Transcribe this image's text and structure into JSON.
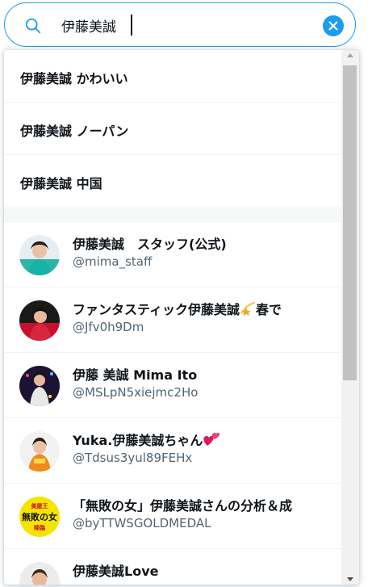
{
  "search": {
    "value": "伊藤美誠",
    "icons": {
      "search": "search-icon",
      "clear": "close-icon"
    }
  },
  "suggestions": [
    {
      "label": "伊藤美誠 かわいい"
    },
    {
      "label": "伊藤美誠 ノーパン"
    },
    {
      "label": "伊藤美誠 中国"
    }
  ],
  "users": [
    {
      "name": "伊藤美誠　スタッフ(公式)",
      "handle": "@mima_staff",
      "avatar": "avatar-photo"
    },
    {
      "name": "ファンタスティック伊藤美誠",
      "name_suffix": "春で",
      "name_emoji": "shooting-star-icon",
      "handle": "@Jfv0h9Dm",
      "avatar": "avatar-photo"
    },
    {
      "name": "伊藤 美誠 Mima Ito",
      "handle": "@MSLpN5xiejmc2Ho",
      "avatar": "avatar-photo"
    },
    {
      "name": "Yuka.伊藤美誠ちゃん",
      "name_emoji": "two-hearts-icon",
      "handle": "@Tdsus3yul89FEHx",
      "avatar": "avatar-photo"
    },
    {
      "name": "「無敗の女」伊藤美誠さんの分析＆成",
      "handle": "@byTTWSGOLDMEDAL",
      "avatar": "avatar-logo",
      "avatar_text": {
        "top": "美屋王",
        "main": "無敗の女",
        "bottom": "降臨"
      }
    },
    {
      "name": "伊藤美誠Love",
      "handle": "",
      "avatar": "avatar-photo"
    }
  ],
  "colors": {
    "accent": "#1d9bf0",
    "text_primary": "#0f1419",
    "text_secondary": "#536471",
    "divider": "#eff3f4",
    "logo_bg": "#f5e400"
  }
}
